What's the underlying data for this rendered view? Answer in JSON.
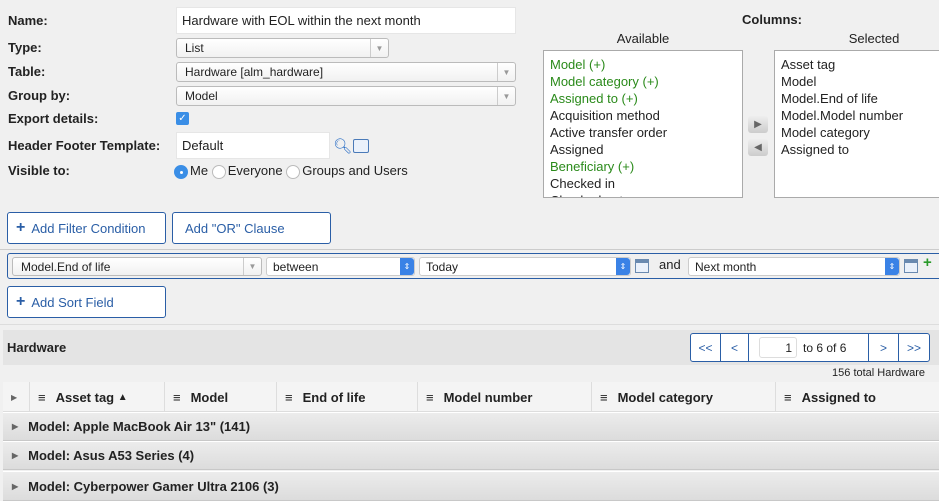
{
  "form": {
    "name_label": "Name:",
    "name_value": "Hardware with EOL within the next month",
    "type_label": "Type:",
    "type_value": "List",
    "table_label": "Table:",
    "table_value": "Hardware [alm_hardware]",
    "groupby_label": "Group by:",
    "groupby_value": "Model",
    "export_label": "Export details:",
    "export_checked": true,
    "hft_label": "Header Footer Template:",
    "hft_value": "Default",
    "visible_label": "Visible to:",
    "visible_options": [
      "Me",
      "Everyone",
      "Groups and Users"
    ],
    "visible_selected": "Me"
  },
  "columns": {
    "label": "Columns:",
    "available_label": "Available",
    "selected_label": "Selected",
    "available": [
      {
        "text": "Model (+)",
        "expandable": true
      },
      {
        "text": "Model category (+)",
        "expandable": true
      },
      {
        "text": "Assigned to (+)",
        "expandable": true
      },
      {
        "text": "Acquisition method",
        "expandable": false
      },
      {
        "text": "Active transfer order",
        "expandable": false
      },
      {
        "text": "Assigned",
        "expandable": false
      },
      {
        "text": "Beneficiary (+)",
        "expandable": true
      },
      {
        "text": "Checked in",
        "expandable": false
      },
      {
        "text": "Checked out",
        "expandable": false
      }
    ],
    "selected": [
      "Asset tag",
      "Model",
      "Model.End of life",
      "Model.Model number",
      "Model category",
      "Assigned to"
    ]
  },
  "filter": {
    "add_condition": "Add Filter Condition",
    "add_or": "Add \"OR\" Clause",
    "field": "Model.End of life",
    "operator": "between",
    "from": "Today",
    "and": "and",
    "to": "Next month",
    "add_sort": "Add Sort Field"
  },
  "list": {
    "title": "Hardware",
    "pager": {
      "first": "<<",
      "prev": "<",
      "page": "1",
      "range": "to 6 of 6",
      "next": ">",
      "last": ">>"
    },
    "total": "156 total Hardware",
    "headers": [
      "Asset tag",
      "Model",
      "End of life",
      "Model number",
      "Model category",
      "Assigned to"
    ],
    "sort_indicator": "▲",
    "groups": [
      "Model: Apple MacBook Air 13\" (141)",
      "Model: Asus A53 Series (4)",
      "Model: Cyberpower Gamer Ultra 2106 (3)"
    ]
  },
  "colors": {
    "accent": "#2a5ea6",
    "green": "#2a8a1a",
    "checkbox": "#3a8ee6"
  }
}
